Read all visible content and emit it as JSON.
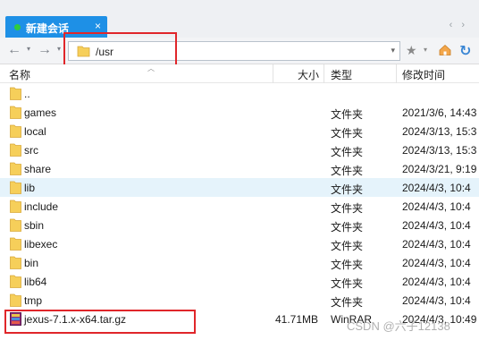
{
  "tab": {
    "label": "新建会话",
    "close": "×"
  },
  "tab_nav": {
    "prev": "‹",
    "next": "›"
  },
  "toolbar": {
    "back": "←",
    "forward": "→",
    "drop": "▾",
    "path": "/usr",
    "star": "★",
    "refresh": "↻"
  },
  "header": {
    "name": "名称",
    "size": "大小",
    "type": "类型",
    "modified": "修改时间"
  },
  "rows": [
    {
      "name": "..",
      "size": "",
      "type": "",
      "date": "",
      "icon": "folder-icon",
      "selected": false
    },
    {
      "name": "games",
      "size": "",
      "type": "文件夹",
      "date": "2021/3/6, 14:43",
      "icon": "folder-icon",
      "selected": false
    },
    {
      "name": "local",
      "size": "",
      "type": "文件夹",
      "date": "2024/3/13, 15:3",
      "icon": "folder-icon",
      "selected": false
    },
    {
      "name": "src",
      "size": "",
      "type": "文件夹",
      "date": "2024/3/13, 15:3",
      "icon": "folder-icon",
      "selected": false
    },
    {
      "name": "share",
      "size": "",
      "type": "文件夹",
      "date": "2024/3/21, 9:19",
      "icon": "folder-icon",
      "selected": false
    },
    {
      "name": "lib",
      "size": "",
      "type": "文件夹",
      "date": "2024/4/3, 10:4",
      "icon": "folder-icon",
      "selected": true
    },
    {
      "name": "include",
      "size": "",
      "type": "文件夹",
      "date": "2024/4/3, 10:4",
      "icon": "folder-icon",
      "selected": false
    },
    {
      "name": "sbin",
      "size": "",
      "type": "文件夹",
      "date": "2024/4/3, 10:4",
      "icon": "folder-icon",
      "selected": false
    },
    {
      "name": "libexec",
      "size": "",
      "type": "文件夹",
      "date": "2024/4/3, 10:4",
      "icon": "folder-icon",
      "selected": false
    },
    {
      "name": "bin",
      "size": "",
      "type": "文件夹",
      "date": "2024/4/3, 10:4",
      "icon": "folder-icon",
      "selected": false
    },
    {
      "name": "lib64",
      "size": "",
      "type": "文件夹",
      "date": "2024/4/3, 10:4",
      "icon": "folder-icon",
      "selected": false
    },
    {
      "name": "tmp",
      "size": "",
      "type": "文件夹",
      "date": "2024/4/3, 10:4",
      "icon": "folder-icon",
      "selected": false
    },
    {
      "name": "jexus-7.1.x-x64.tar.gz",
      "size": "41.71MB",
      "type": "WinRAR",
      "date": "2024/4/3, 10:49",
      "icon": "archive-icon",
      "selected": false
    }
  ],
  "watermark": "CSDN @六子12138",
  "colors": {
    "tab": "#1e90e6",
    "selected_row": "#e5f3fb",
    "highlight": "#e0262a",
    "folder": "#f6cf5a"
  }
}
